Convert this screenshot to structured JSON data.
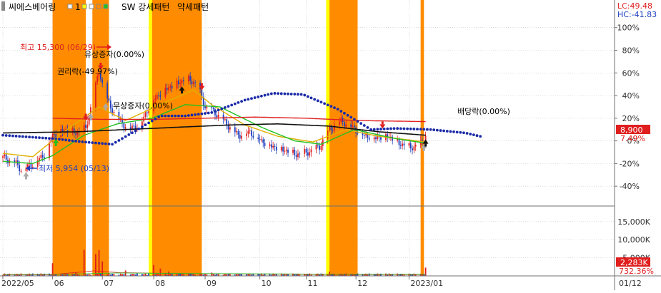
{
  "legend": {
    "stock_name": "씨에스베어링",
    "item_1": "1",
    "item_2": "SW 강세패턴",
    "item_3": "약세패턴"
  },
  "info": {
    "lc": "LC:49.48",
    "hc": "HC:-41.83",
    "current_price": "8,900",
    "current_pct": "7.49%",
    "current_volume": "2,283K",
    "volume_pct": "732.36%"
  },
  "colors": {
    "up": "#e01e1e",
    "down": "#1f3fbf",
    "strong_pattern": "#ff8c00",
    "weak_pattern": "#ffff00",
    "ma_short": "#e0b000",
    "ma_green": "#22c022",
    "ma_red": "#e02020",
    "ma_black": "#111111",
    "dots": "#1a2aa8",
    "grid": "#c8c8c8",
    "price_badge": "#e01e1e"
  },
  "annotations": {
    "high": "최고 15,300 (06/29)",
    "low": "최저 5,954 (05/13)",
    "rights_issue": "유상증자(0.00%)",
    "ex_rights": "권리락(-49.97%)",
    "bonus_issue": "무상증자(0.00%)",
    "ex_dividend": "배당락(0.00%)"
  },
  "chart_data": {
    "type": "candlestick",
    "title": "씨에스베어링",
    "x_ticks": [
      "2022/05",
      "06",
      "07",
      "08",
      "09",
      "10",
      "11",
      "12",
      "2023/01"
    ],
    "bottom_right_label": "01/12",
    "price_axis": {
      "unit": "% from reference",
      "ticks": [
        "100%",
        "80%",
        "60%",
        "40%",
        "20%",
        "0%",
        "-20%",
        "-40%"
      ],
      "ylim": [
        -55,
        108
      ]
    },
    "volume_axis": {
      "ticks": [
        "15,000K",
        "10,000K",
        "5,000K"
      ],
      "ylim": [
        0,
        18500
      ]
    },
    "pattern_zones": [
      {
        "type": "strong",
        "from": "2022-06-01",
        "to": "2022-06-21"
      },
      {
        "type": "strong",
        "from": "2022-06-25",
        "to": "2022-07-05"
      },
      {
        "type": "weak",
        "from": "2022-07-29",
        "to": "2022-07-31"
      },
      {
        "type": "strong",
        "from": "2022-07-31",
        "to": "2022-08-30"
      },
      {
        "type": "weak",
        "from": "2022-11-13",
        "to": "2022-11-15"
      },
      {
        "type": "strong",
        "from": "2022-11-15",
        "to": "2022-12-02"
      },
      {
        "type": "strong",
        "from": "2023-01-09",
        "to": "2023-01-11"
      }
    ],
    "price_keypoints": [
      [
        "2022-05-03",
        -15
      ],
      [
        "2022-05-10",
        -20
      ],
      [
        "2022-05-13",
        -25
      ],
      [
        "2022-05-20",
        -20
      ],
      [
        "2022-05-27",
        -12
      ],
      [
        "2022-06-01",
        5
      ],
      [
        "2022-06-08",
        10
      ],
      [
        "2022-06-15",
        7
      ],
      [
        "2022-06-21",
        11
      ],
      [
        "2022-06-25",
        35
      ],
      [
        "2022-06-29",
        62
      ],
      [
        "2022-07-03",
        38
      ],
      [
        "2022-07-10",
        20
      ],
      [
        "2022-07-17",
        10
      ],
      [
        "2022-07-24",
        15
      ],
      [
        "2022-07-31",
        35
      ],
      [
        "2022-08-07",
        45
      ],
      [
        "2022-08-14",
        50
      ],
      [
        "2022-08-21",
        55
      ],
      [
        "2022-08-27",
        50
      ],
      [
        "2022-09-01",
        30
      ],
      [
        "2022-09-07",
        25
      ],
      [
        "2022-09-14",
        15
      ],
      [
        "2022-09-21",
        5
      ],
      [
        "2022-09-28",
        8
      ],
      [
        "2022-10-05",
        0
      ],
      [
        "2022-10-12",
        -5
      ],
      [
        "2022-10-19",
        -8
      ],
      [
        "2022-10-26",
        -12
      ],
      [
        "2022-11-02",
        -10
      ],
      [
        "2022-11-09",
        -5
      ],
      [
        "2022-11-15",
        10
      ],
      [
        "2022-11-22",
        18
      ],
      [
        "2022-11-29",
        12
      ],
      [
        "2022-12-06",
        5
      ],
      [
        "2022-12-13",
        3
      ],
      [
        "2022-12-20",
        5
      ],
      [
        "2022-12-27",
        -2
      ],
      [
        "2023-01-03",
        -6
      ],
      [
        "2023-01-10",
        -2
      ],
      [
        "2023-01-12",
        6
      ]
    ],
    "series": [
      {
        "name": "MA short",
        "color": "#e0b000",
        "points": [
          [
            "2022-05-02",
            -11
          ],
          [
            "2022-05-20",
            -14
          ],
          [
            "2022-06-05",
            5
          ],
          [
            "2022-06-29",
            30
          ],
          [
            "2022-07-15",
            18
          ],
          [
            "2022-08-05",
            32
          ],
          [
            "2022-08-25",
            45
          ],
          [
            "2022-09-05",
            32
          ],
          [
            "2022-09-25",
            14
          ],
          [
            "2022-10-15",
            4
          ],
          [
            "2022-11-05",
            -1
          ],
          [
            "2022-11-25",
            10
          ],
          [
            "2022-12-15",
            4
          ],
          [
            "2023-01-12",
            -1
          ]
        ]
      },
      {
        "name": "MA green",
        "color": "#22c022",
        "points": [
          [
            "2022-05-02",
            -18
          ],
          [
            "2022-05-20",
            -20
          ],
          [
            "2022-06-01",
            -13
          ],
          [
            "2022-06-20",
            5
          ],
          [
            "2022-07-10",
            15
          ],
          [
            "2022-07-31",
            20
          ],
          [
            "2022-08-20",
            32
          ],
          [
            "2022-09-10",
            30
          ],
          [
            "2022-10-05",
            12
          ],
          [
            "2022-10-25",
            0
          ],
          [
            "2022-11-10",
            -3
          ],
          [
            "2022-11-30",
            10
          ],
          [
            "2022-12-25",
            2
          ],
          [
            "2023-01-12",
            -2
          ]
        ]
      },
      {
        "name": "MA red",
        "color": "#e02020",
        "points": [
          [
            "2022-06-01",
            20
          ],
          [
            "2022-07-01",
            19
          ],
          [
            "2022-08-01",
            19
          ],
          [
            "2022-09-01",
            20
          ],
          [
            "2022-10-01",
            21
          ],
          [
            "2022-11-01",
            20
          ],
          [
            "2022-12-01",
            18
          ],
          [
            "2023-01-12",
            17
          ]
        ]
      },
      {
        "name": "MA black",
        "color": "#111111",
        "points": [
          [
            "2022-05-02",
            7
          ],
          [
            "2022-06-15",
            8
          ],
          [
            "2022-07-15",
            10
          ],
          [
            "2022-08-15",
            12
          ],
          [
            "2022-09-15",
            14
          ],
          [
            "2022-10-15",
            15
          ],
          [
            "2022-11-15",
            13
          ],
          [
            "2022-12-15",
            8
          ],
          [
            "2023-01-12",
            5
          ]
        ]
      },
      {
        "name": "dots",
        "color": "#1a2aa8",
        "points": [
          [
            "2022-05-02",
            5
          ],
          [
            "2022-06-01",
            2
          ],
          [
            "2022-06-20",
            -1
          ],
          [
            "2022-07-07",
            -3
          ],
          [
            "2022-07-20",
            8
          ],
          [
            "2022-08-05",
            22
          ],
          [
            "2022-08-20",
            22
          ],
          [
            "2022-09-05",
            25
          ],
          [
            "2022-09-25",
            36
          ],
          [
            "2022-10-12",
            42
          ],
          [
            "2022-10-30",
            41
          ],
          [
            "2022-11-20",
            28
          ],
          [
            "2022-12-10",
            10
          ],
          [
            "2022-12-25",
            11
          ],
          [
            "2023-01-15",
            10
          ],
          [
            "2023-02-05",
            7
          ],
          [
            "2023-02-14",
            4
          ]
        ]
      }
    ],
    "volume_spikes": [
      [
        "2022-06-01",
        3500
      ],
      [
        "2022-06-05",
        1200
      ],
      [
        "2022-06-15",
        900
      ],
      [
        "2022-06-20",
        7200
      ],
      [
        "2022-06-27",
        6000
      ],
      [
        "2022-06-29",
        7100
      ],
      [
        "2022-07-01",
        4000
      ],
      [
        "2022-07-03",
        1800
      ],
      [
        "2022-07-15",
        1500
      ],
      [
        "2022-08-01",
        3000
      ],
      [
        "2022-08-05",
        2000
      ],
      [
        "2022-08-10",
        1200
      ],
      [
        "2022-08-20",
        1100
      ],
      [
        "2022-09-05",
        900
      ],
      [
        "2022-11-15",
        1200
      ],
      [
        "2022-11-20",
        2000
      ],
      [
        "2022-11-25",
        700
      ],
      [
        "2022-12-15",
        500
      ],
      [
        "2023-01-12",
        2283
      ]
    ],
    "events": [
      {
        "label": "최고 15,300 (06/29)",
        "date": "2022-06-29",
        "value": 62
      },
      {
        "label": "최저 5,954 (05/13)",
        "date": "2022-05-13",
        "value": -25
      },
      {
        "label": "유상증자(0.00%)",
        "date": "2022-06-27"
      },
      {
        "label": "권리락(-49.97%)",
        "date": "2022-06-22"
      },
      {
        "label": "무상증자(0.00%)",
        "date": "2022-07-01"
      },
      {
        "label": "배당락(0.00%)",
        "date": "2023-01-02"
      }
    ]
  }
}
